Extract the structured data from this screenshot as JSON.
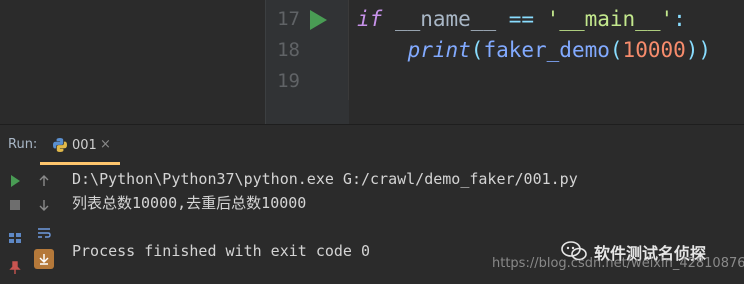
{
  "editor": {
    "gutter": [
      {
        "line_number": "17",
        "has_run_marker": true
      },
      {
        "line_number": "18",
        "has_run_marker": false
      },
      {
        "line_number": "19",
        "has_run_marker": false
      }
    ],
    "code": {
      "line17": {
        "kw": "if",
        "name": " __name__ ",
        "op": "==",
        "str": " '__main__'",
        "colon": ":"
      },
      "line18": {
        "indent": "    ",
        "fn": "print",
        "open": "(",
        "call": "faker_demo",
        "open2": "(",
        "num": "10000",
        "close": "))"
      }
    }
  },
  "run": {
    "label": "Run:",
    "tab": {
      "label": "001",
      "close": "×",
      "icon": "python-icon"
    },
    "console": [
      "D:\\Python\\Python37\\python.exe G:/crawl/demo_faker/001.py",
      "列表总数10000,去重后总数10000",
      "",
      "Process finished with exit code 0"
    ]
  },
  "watermark": {
    "title": "软件测试名侦探",
    "url": "https://blog.csdn.net/weixin_42810876"
  },
  "colors": {
    "run_green": "#499c54",
    "tab_underline": "#ffc66d",
    "background": "#2b2b2b"
  }
}
